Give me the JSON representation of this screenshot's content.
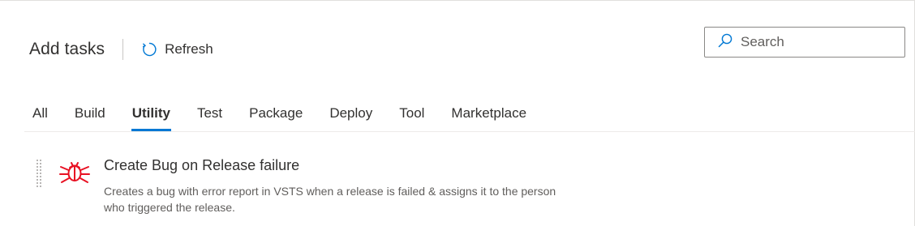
{
  "header": {
    "title": "Add tasks",
    "refresh_label": "Refresh",
    "refresh_icon": "refresh-icon"
  },
  "search": {
    "placeholder": "Search",
    "icon": "search-icon"
  },
  "tabs": [
    {
      "label": "All",
      "selected": false
    },
    {
      "label": "Build",
      "selected": false
    },
    {
      "label": "Utility",
      "selected": true
    },
    {
      "label": "Test",
      "selected": false
    },
    {
      "label": "Package",
      "selected": false
    },
    {
      "label": "Deploy",
      "selected": false
    },
    {
      "label": "Tool",
      "selected": false
    },
    {
      "label": "Marketplace",
      "selected": false
    }
  ],
  "tasks": [
    {
      "title": "Create Bug on Release failure",
      "description": "Creates a bug with error report in VSTS when a release is failed & assigns it to the person who triggered the release.",
      "icon": "bug-icon"
    }
  ],
  "colors": {
    "accent": "#0078d4",
    "bug_icon": "#e81123",
    "text_primary": "#323130",
    "text_secondary": "#605e5c"
  }
}
